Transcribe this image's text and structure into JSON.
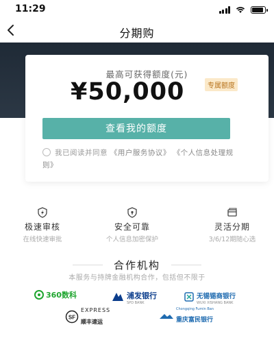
{
  "status_bar": {
    "time": "11:29",
    "battery_level": 0.9
  },
  "nav": {
    "title": "分期购"
  },
  "card": {
    "subtitle": "最高可获得额度(元)",
    "amount": "¥50,000",
    "tag": "专属额度",
    "cta_label": "查看我的额度",
    "agreement_prefix": "我已阅读并同意",
    "agreement_link_1": "《用户服务协议》",
    "agreement_link_2": "《个人信息处理规则》"
  },
  "features": [
    {
      "icon": "lightning-shield-icon",
      "title": "极速审核",
      "desc": "在线快速审批"
    },
    {
      "icon": "shield-lock-icon",
      "title": "安全可靠",
      "desc": "个人信息加密保护"
    },
    {
      "icon": "card-icon",
      "title": "灵活分期",
      "desc": "3/6/12期随心选"
    }
  ],
  "partners": {
    "title": "合作机构",
    "desc": "本服务与持牌金融机构合作，包括但不限于",
    "logos": [
      {
        "name": "360数科",
        "color": "#1fa52f"
      },
      {
        "name": "浦发银行",
        "sub": "SPD BANK",
        "color": "#0b3d8c"
      },
      {
        "name": "无锡锡商银行",
        "sub": "WUXI XISHANG BANK",
        "color": "#1f6bb0"
      },
      {
        "name": "顺丰速运",
        "sub": "EXPRESS",
        "color": "#222222"
      },
      {
        "name": "重庆富民银行",
        "sub": "Chongqing Fumin Ban",
        "color": "#1f6bb0"
      }
    ]
  }
}
